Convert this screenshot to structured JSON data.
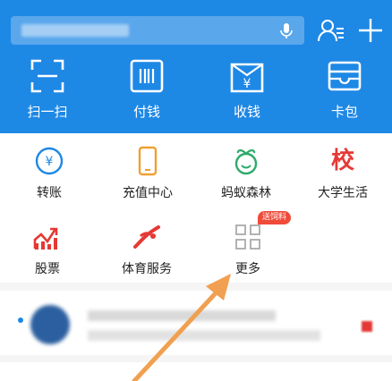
{
  "header": {
    "search": {
      "placeholder": ""
    },
    "icons": {
      "mic": "microphone-icon",
      "contacts": "contacts-icon",
      "add": "plus-icon"
    }
  },
  "quick_actions": [
    {
      "label": "扫一扫",
      "icon": "scan-icon"
    },
    {
      "label": "付钱",
      "icon": "pay-icon"
    },
    {
      "label": "收钱",
      "icon": "receive-money-icon"
    },
    {
      "label": "卡包",
      "icon": "card-wallet-icon"
    }
  ],
  "grid": {
    "items": [
      {
        "label": "转账",
        "icon": "transfer-icon"
      },
      {
        "label": "充值中心",
        "icon": "phone-recharge-icon"
      },
      {
        "label": "蚂蚁森林",
        "icon": "ant-forest-icon"
      },
      {
        "label": "大学生活",
        "icon": "campus-icon",
        "icon_text": "校"
      },
      {
        "label": "股票",
        "icon": "stocks-icon"
      },
      {
        "label": "体育服务",
        "icon": "sports-icon"
      },
      {
        "label": "更多",
        "icon": "more-grid-icon",
        "badge": "送饲料"
      }
    ]
  },
  "colors": {
    "brand_blue": "#1e88e5",
    "accent_red": "#e53935",
    "arrow_orange": "#f0a050"
  }
}
